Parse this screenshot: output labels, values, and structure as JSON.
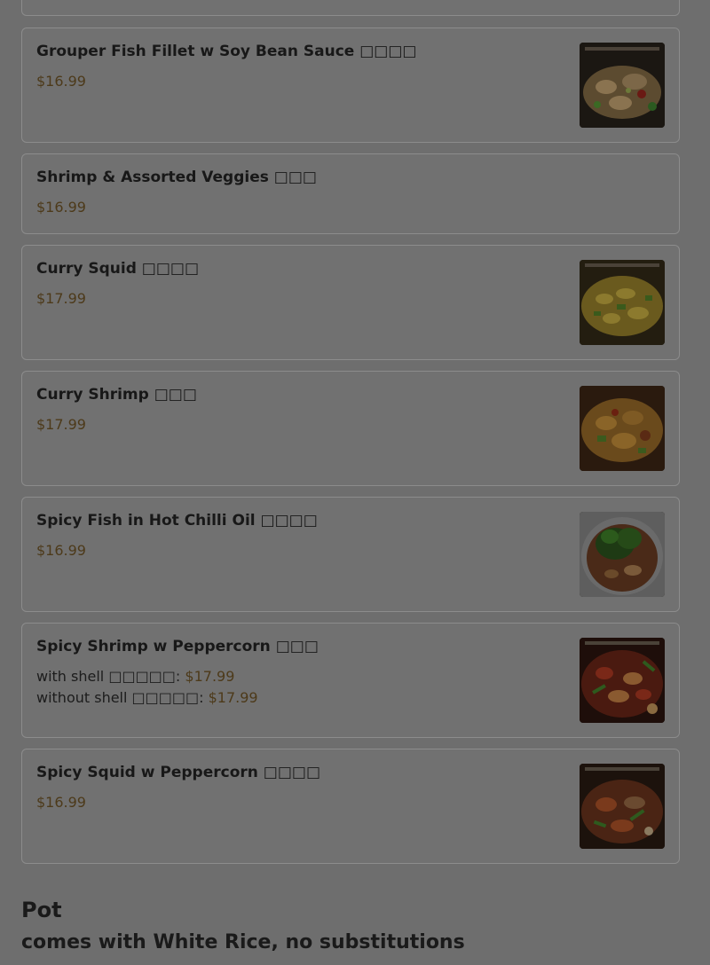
{
  "items": [
    {
      "name": "Grouper Fish Fillet w Soy Bean Sauce □□□□",
      "price": "$16.99",
      "image": "grouper-fish-photo"
    },
    {
      "name": "Shrimp & Assorted Veggies □□□",
      "price": "$16.99"
    },
    {
      "name": "Curry Squid □□□□",
      "price": "$17.99",
      "image": "curry-squid-photo"
    },
    {
      "name": "Curry Shrimp □□□",
      "price": "$17.99",
      "image": "curry-shrimp-photo"
    },
    {
      "name": "Spicy Fish in Hot Chilli Oil □□□□",
      "price": "$16.99",
      "image": "spicy-fish-photo"
    },
    {
      "name": "Spicy Shrimp w Peppercorn □□□",
      "options": [
        {
          "label": "with shell □□□□□:",
          "price": "$17.99"
        },
        {
          "label": "without shell □□□□□:",
          "price": "$17.99"
        }
      ],
      "image": "spicy-shrimp-photo"
    },
    {
      "name": "Spicy Squid w Peppercorn □□□□",
      "price": "$16.99",
      "image": "spicy-squid-photo"
    }
  ],
  "section": {
    "title": "Pot",
    "subtitle": "comes with White Rice, no substitutions"
  }
}
